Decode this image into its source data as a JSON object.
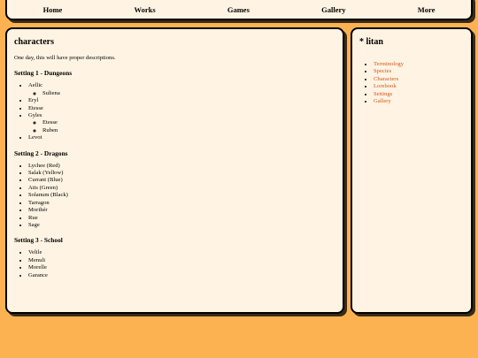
{
  "nav": [
    "Home",
    "Works",
    "Games",
    "Gallery",
    "More"
  ],
  "main": {
    "title": "characters",
    "intro": "One day, this will have proper descriptions.",
    "settings": [
      {
        "title": "Setting 1 - Dungeons",
        "items": [
          {
            "name": "Aellic",
            "children": [
              "Suliena"
            ]
          },
          {
            "name": "Eryl",
            "children": []
          },
          {
            "name": "Etesse",
            "children": []
          },
          {
            "name": "Gyles",
            "children": [
              "Etesse",
              "Ruben"
            ]
          },
          {
            "name": "Levot",
            "children": []
          }
        ]
      },
      {
        "title": "Setting 2 - Dragons",
        "items": [
          {
            "name": "Lychee (Red)",
            "children": []
          },
          {
            "name": "Salak (Yellow)",
            "children": []
          },
          {
            "name": "Currant (Blue)",
            "children": []
          },
          {
            "name": "Atis (Green)",
            "children": []
          },
          {
            "name": "Solanum (Black)",
            "children": []
          },
          {
            "name": "Tarragon",
            "children": []
          },
          {
            "name": "Morihér",
            "children": []
          },
          {
            "name": "Rue",
            "children": []
          },
          {
            "name": "Sage",
            "children": []
          }
        ]
      },
      {
        "title": "Setting 3 - School",
        "items": [
          {
            "name": "Velile",
            "children": []
          },
          {
            "name": "Menuli",
            "children": []
          },
          {
            "name": "Morelle",
            "children": []
          },
          {
            "name": "Garance",
            "children": []
          }
        ]
      }
    ]
  },
  "side": {
    "title": "* litan",
    "links": [
      "Terminology",
      "Species",
      "Characters",
      "Lorebook",
      "Settings",
      "Gallery"
    ]
  },
  "colors": {
    "background": "#fdb252",
    "panel": "#fff4e3",
    "link": "#d2541b"
  }
}
